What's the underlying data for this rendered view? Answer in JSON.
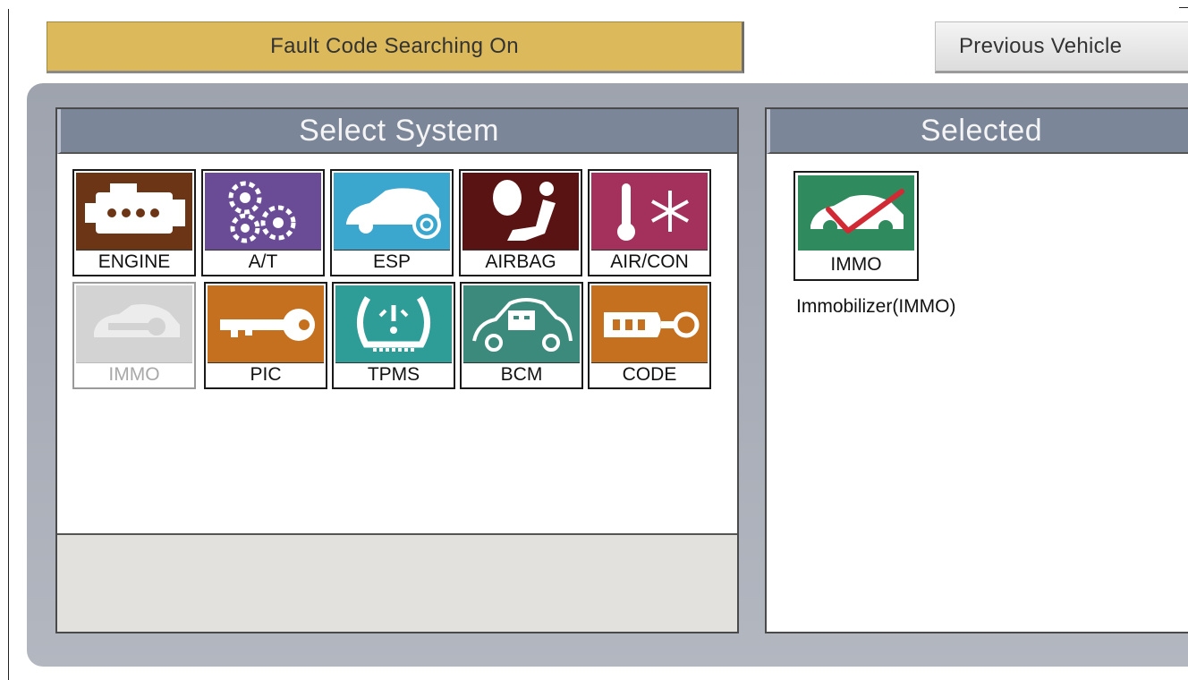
{
  "toolbar": {
    "fault_code_label": "Fault Code Searching On",
    "previous_vehicle_label": "Previous Vehicle"
  },
  "select_panel": {
    "title": "Select System",
    "systems": [
      {
        "label": "ENGINE",
        "icon": "engine-icon",
        "color": "#6b3516",
        "enabled": true
      },
      {
        "label": "A/T",
        "icon": "gears-icon",
        "color": "#6a4b96",
        "enabled": true
      },
      {
        "label": "ESP",
        "icon": "car-wheel-icon",
        "color": "#3ba7cf",
        "enabled": true
      },
      {
        "label": "AIRBAG",
        "icon": "airbag-icon",
        "color": "#5a1313",
        "enabled": true
      },
      {
        "label": "AIR/CON",
        "icon": "thermometer-snowflake-icon",
        "color": "#a4305c",
        "enabled": true
      },
      {
        "label": "IMMO",
        "icon": "car-key-icon",
        "color": "#d3d3d3",
        "enabled": false
      },
      {
        "label": "PIC",
        "icon": "key-icon",
        "color": "#c5701f",
        "enabled": true
      },
      {
        "label": "TPMS",
        "icon": "tire-pressure-icon",
        "color": "#2e9d98",
        "enabled": true
      },
      {
        "label": "BCM",
        "icon": "car-battery-icon",
        "color": "#3c8a7b",
        "enabled": true
      },
      {
        "label": "CODE",
        "icon": "key-fob-icon",
        "color": "#c5701f",
        "enabled": true
      }
    ]
  },
  "selected_panel": {
    "title": "Selected",
    "item": {
      "label": "IMMO",
      "icon": "immobilizer-check-icon",
      "color": "#2f8a5e",
      "description": "Immobilizer(IMMO)"
    }
  }
}
